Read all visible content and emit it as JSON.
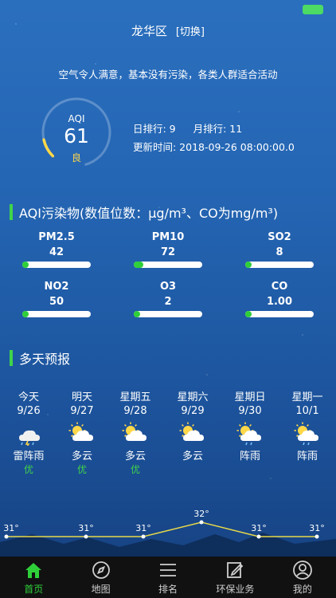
{
  "header": {
    "location": "龙华区",
    "switch_label": "[切换]"
  },
  "summary": "空气令人满意，基本没有污染，各类人群适合活动",
  "aqi": {
    "label": "AQI",
    "value": "61",
    "level": "良",
    "gauge_fraction": 0.12,
    "day_rank_label": "日排行: 9",
    "month_rank_label": "月排行: 11",
    "update_label": "更新时间: 2018-09-26 08:00:00.0"
  },
  "pollutants_section": {
    "title": "AQI污染物(数值位数：μg/m³、CO为mg/m³)"
  },
  "pollutants": [
    {
      "name": "PM2.5",
      "value": "42",
      "fraction": 0.06
    },
    {
      "name": "PM10",
      "value": "72",
      "fraction": 0.14
    },
    {
      "name": "SO2",
      "value": "8",
      "fraction": 0.02
    },
    {
      "name": "NO2",
      "value": "50",
      "fraction": 0.06
    },
    {
      "name": "O3",
      "value": "2",
      "fraction": 0.02
    },
    {
      "name": "CO",
      "value": "1.00",
      "fraction": 0.02
    }
  ],
  "forecast_section": {
    "title": "多天预报"
  },
  "forecast": [
    {
      "day": "今天",
      "date": "9/26",
      "icon": "thunderstorm-icon",
      "weather": "雷阵雨",
      "quality": "优",
      "temp": "31°",
      "temp_value": 31
    },
    {
      "day": "明天",
      "date": "9/27",
      "icon": "partly-cloudy-icon",
      "weather": "多云",
      "quality": "优",
      "temp": "31°",
      "temp_value": 31
    },
    {
      "day": "星期五",
      "date": "9/28",
      "icon": "partly-cloudy-icon",
      "weather": "多云",
      "quality": "优",
      "temp": "31°",
      "temp_value": 31
    },
    {
      "day": "星期六",
      "date": "9/29",
      "icon": "partly-cloudy-icon",
      "weather": "多云",
      "quality": "",
      "temp": "32°",
      "temp_value": 32
    },
    {
      "day": "星期日",
      "date": "9/30",
      "icon": "shower-icon",
      "weather": "阵雨",
      "quality": "",
      "temp": "31°",
      "temp_value": 31
    },
    {
      "day": "星期一",
      "date": "10/1",
      "icon": "shower-icon",
      "weather": "阵雨",
      "quality": "",
      "temp": "31°",
      "temp_value": 31
    }
  ],
  "tabbar": [
    {
      "label": "首页",
      "icon": "home-icon",
      "active": true
    },
    {
      "label": "地图",
      "icon": "compass-icon",
      "active": false
    },
    {
      "label": "排名",
      "icon": "list-icon",
      "active": false
    },
    {
      "label": "环保业务",
      "icon": "edit-icon",
      "active": false
    },
    {
      "label": "我的",
      "icon": "user-icon",
      "active": false
    }
  ],
  "colors": {
    "accent_green": "#2fcf3a",
    "aqi_level_yellow": "#ffd84a",
    "line_yellow": "#e8d84a"
  }
}
